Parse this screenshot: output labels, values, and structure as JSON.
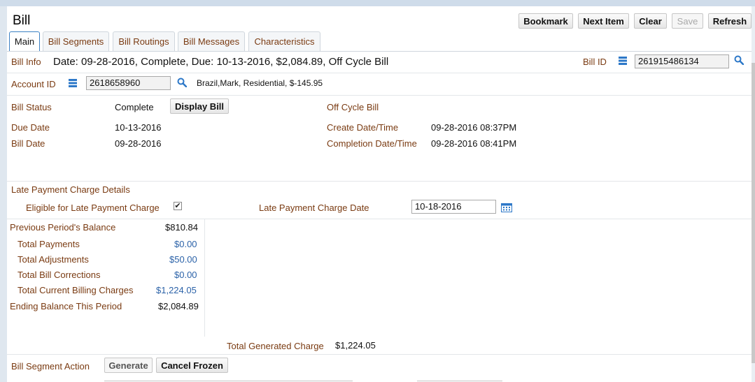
{
  "header": {
    "title": "Bill",
    "buttons": {
      "bookmark": "Bookmark",
      "next_item": "Next Item",
      "clear": "Clear",
      "save": "Save",
      "refresh": "Refresh"
    }
  },
  "tabs": [
    "Main",
    "Bill Segments",
    "Bill Routings",
    "Bill Messages",
    "Characteristics"
  ],
  "bill_info": {
    "label": "Bill Info",
    "summary": "Date: 09-28-2016, Complete, Due: 10-13-2016, $2,084.89, Off Cycle Bill",
    "bill_id_label": "Bill ID",
    "bill_id_value": "261915486134"
  },
  "account": {
    "label": "Account ID",
    "value": "2618658960",
    "description": "Brazil,Mark, Residential, $-145.95"
  },
  "status": {
    "bill_status_label": "Bill Status",
    "bill_status_value": "Complete",
    "display_bill_button": "Display Bill",
    "off_cycle": "Off Cycle Bill",
    "due_date_label": "Due Date",
    "due_date_value": "10-13-2016",
    "bill_date_label": "Bill Date",
    "bill_date_value": "09-28-2016",
    "create_label": "Create Date/Time",
    "create_value": "09-28-2016 08:37PM",
    "completion_label": "Completion Date/Time",
    "completion_value": "09-28-2016 08:41PM"
  },
  "late_payment": {
    "section_title": "Late Payment Charge Details",
    "eligible_label": "Eligible for Late Payment Charge",
    "eligible_checked": true,
    "date_label": "Late Payment Charge Date",
    "date_value": "10-18-2016"
  },
  "balances": {
    "previous_label": "Previous Period's Balance",
    "previous_value": "$810.84",
    "payments_label": "Total Payments",
    "payments_value": "$0.00",
    "adjustments_label": "Total Adjustments",
    "adjustments_value": "$50.00",
    "corrections_label": "Total Bill Corrections",
    "corrections_value": "$0.00",
    "current_label": "Total Current Billing Charges",
    "current_value": "$1,224.05",
    "ending_label": "Ending Balance This Period",
    "ending_value": "$2,084.89",
    "generated_label": "Total Generated Charge",
    "generated_value": "$1,224.05"
  },
  "segment_action": {
    "label": "Bill Segment Action",
    "generate": "Generate",
    "cancel_frozen": "Cancel Frozen"
  },
  "colors": {
    "label": "#7a3b12",
    "link": "#2b62a8",
    "icon": "#2d78c8"
  },
  "icons": [
    "list-icon",
    "search-icon",
    "calendar-icon"
  ]
}
